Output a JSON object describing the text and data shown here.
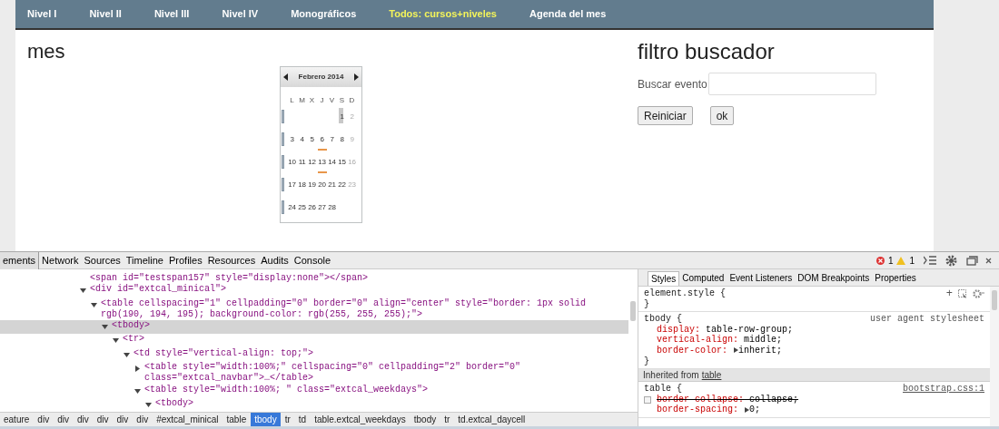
{
  "nav": {
    "items": [
      {
        "label": "Nivel I",
        "selected": false
      },
      {
        "label": "Nivel II",
        "selected": false
      },
      {
        "label": "Nivel III",
        "selected": false
      },
      {
        "label": "Nivel IV",
        "selected": false
      },
      {
        "label": "Monográficos",
        "selected": false
      },
      {
        "label": "Todos: cursos+niveles",
        "selected": true
      },
      {
        "label": "Agenda del mes",
        "selected": false
      }
    ]
  },
  "month_section": {
    "heading": "mes",
    "calendar": {
      "title": "Febrero 2014",
      "weekdays": [
        "L",
        "M",
        "X",
        "J",
        "V",
        "S",
        "D"
      ],
      "weeks": [
        [
          {
            "kind": "empty"
          },
          {
            "kind": "empty"
          },
          {
            "kind": "empty"
          },
          {
            "kind": "empty"
          },
          {
            "kind": "empty"
          },
          {
            "label": "1",
            "kind": "weekday",
            "event": false,
            "today": true
          },
          {
            "label": "2",
            "kind": "sunday",
            "event": false,
            "today": false
          }
        ],
        [
          {
            "label": "3",
            "kind": "weekday",
            "event": false,
            "today": false
          },
          {
            "label": "4",
            "kind": "weekday",
            "event": false,
            "today": false
          },
          {
            "label": "5",
            "kind": "weekday",
            "event": false,
            "today": false
          },
          {
            "label": "6",
            "kind": "weekday",
            "event": true,
            "today": false
          },
          {
            "label": "7",
            "kind": "weekday",
            "event": false,
            "today": false
          },
          {
            "label": "8",
            "kind": "weekday",
            "event": false,
            "today": false
          },
          {
            "label": "9",
            "kind": "sunday",
            "event": false,
            "today": false
          }
        ],
        [
          {
            "label": "10",
            "kind": "weekday",
            "event": false,
            "today": false
          },
          {
            "label": "11",
            "kind": "weekday",
            "event": false,
            "today": false
          },
          {
            "label": "12",
            "kind": "weekday",
            "event": false,
            "today": false
          },
          {
            "label": "13",
            "kind": "weekday",
            "event": true,
            "today": false
          },
          {
            "label": "14",
            "kind": "weekday",
            "event": false,
            "today": false
          },
          {
            "label": "15",
            "kind": "weekday",
            "event": false,
            "today": false
          },
          {
            "label": "16",
            "kind": "sunday",
            "event": false,
            "today": false
          }
        ],
        [
          {
            "label": "17",
            "kind": "weekday",
            "event": false,
            "today": false
          },
          {
            "label": "18",
            "kind": "weekday",
            "event": false,
            "today": false
          },
          {
            "label": "19",
            "kind": "weekday",
            "event": false,
            "today": false
          },
          {
            "label": "20",
            "kind": "weekday",
            "event": false,
            "today": false
          },
          {
            "label": "21",
            "kind": "weekday",
            "event": false,
            "today": false
          },
          {
            "label": "22",
            "kind": "weekday",
            "event": false,
            "today": false
          },
          {
            "label": "23",
            "kind": "sunday",
            "event": false,
            "today": false
          }
        ],
        [
          {
            "label": "24",
            "kind": "weekday",
            "event": false,
            "today": false
          },
          {
            "label": "25",
            "kind": "weekday",
            "event": false,
            "today": false
          },
          {
            "label": "26",
            "kind": "weekday",
            "event": false,
            "today": false
          },
          {
            "label": "27",
            "kind": "weekday",
            "event": false,
            "today": false
          },
          {
            "label": "28",
            "kind": "weekday",
            "event": false,
            "today": false
          },
          {
            "kind": "empty"
          },
          {
            "kind": "empty"
          }
        ]
      ]
    }
  },
  "filter_section": {
    "heading": "filtro buscador",
    "search_label": "Buscar evento",
    "buttons": [
      "Reiniciar",
      "ok"
    ]
  },
  "devtools": {
    "tabs": [
      {
        "label": "ements",
        "selected": true
      },
      {
        "label": "Network",
        "selected": false
      },
      {
        "label": "Sources",
        "selected": false
      },
      {
        "label": "Timeline",
        "selected": false
      },
      {
        "label": "Profiles",
        "selected": false
      },
      {
        "label": "Resources",
        "selected": false
      },
      {
        "label": "Audits",
        "selected": false
      },
      {
        "label": "Console",
        "selected": false
      }
    ],
    "error_count": "1",
    "warning_count": "1",
    "dom_tree": [
      {
        "kind": "leaf",
        "text": "<span id=\"testspan157\" style=\"display:none\"></span>",
        "selected": false
      },
      {
        "kind": "node",
        "text": "<div id=\"extcal_minical\">",
        "expanded": true,
        "selected": false,
        "children": [
          {
            "kind": "node",
            "text": "<table cellspacing=\"1\" cellpadding=\"0\" border=\"0\" align=\"center\" style=\"border: 1px solid rgb(190, 194, 195); background-color: rgb(255, 255, 255);\">",
            "expanded": true,
            "selected": false,
            "children": [
              {
                "kind": "node",
                "text": "<tbody>",
                "expanded": true,
                "selected": true,
                "children": [
                  {
                    "kind": "node",
                    "text": "<tr>",
                    "expanded": true,
                    "selected": false,
                    "children": [
                      {
                        "kind": "node",
                        "text": "<td style=\"vertical-align: top;\">",
                        "expanded": true,
                        "selected": false,
                        "children": [
                          {
                            "kind": "node",
                            "text": "<table style=\"width:100%;\" cellspacing=\"0\" cellpadding=\"2\" border=\"0\" class=\"extcal_navbar\">…</table>",
                            "expanded": false,
                            "selected": false
                          },
                          {
                            "kind": "node",
                            "text": "<table style=\"width:100%; \" class=\"extcal_weekdays\">",
                            "expanded": true,
                            "selected": false,
                            "children": [
                              {
                                "kind": "node",
                                "text": "<tbody>",
                                "expanded": true,
                                "selected": false
                              }
                            ]
                          }
                        ]
                      }
                    ]
                  }
                ]
              }
            ]
          }
        ]
      }
    ],
    "breadcrumbs": [
      {
        "label": "eature",
        "selected": false
      },
      {
        "label": "div",
        "selected": false
      },
      {
        "label": "div",
        "selected": false
      },
      {
        "label": "div",
        "selected": false
      },
      {
        "label": "div",
        "selected": false
      },
      {
        "label": "div",
        "selected": false
      },
      {
        "label": "div",
        "selected": false
      },
      {
        "label": "#extcal_minical",
        "selected": false
      },
      {
        "label": "table",
        "selected": false
      },
      {
        "label": "tbody",
        "selected": true
      },
      {
        "label": "tr",
        "selected": false
      },
      {
        "label": "td",
        "selected": false
      },
      {
        "label": "table.extcal_weekdays",
        "selected": false
      },
      {
        "label": "tbody",
        "selected": false
      },
      {
        "label": "tr",
        "selected": false
      },
      {
        "label": "td.extcal_daycell",
        "selected": false
      }
    ],
    "styles_tabs": [
      {
        "label": "Styles",
        "selected": true
      },
      {
        "label": "Computed",
        "selected": false
      },
      {
        "label": "Event Listeners",
        "selected": false
      },
      {
        "label": "DOM Breakpoints",
        "selected": false
      },
      {
        "label": "Properties",
        "selected": false
      }
    ],
    "rules": [
      {
        "kind": "rule",
        "selector": "element.style {",
        "add_label": "+",
        "close": "}"
      },
      {
        "kind": "rule",
        "selector": "tbody {",
        "source": "user agent stylesheet",
        "close": "}",
        "properties": [
          {
            "name": "display:",
            "value": "table-row-group;",
            "expandable": false,
            "enabled": true
          },
          {
            "name": "vertical-align:",
            "value": "middle;",
            "expandable": false,
            "enabled": true
          },
          {
            "name": "border-color:",
            "value": "inherit;",
            "expandable": true,
            "enabled": true
          }
        ]
      },
      {
        "kind": "inherited",
        "label": "Inherited from",
        "link": "table"
      },
      {
        "kind": "rule",
        "selector": "table {",
        "source": "bootstrap.css:1",
        "properties": [
          {
            "name": "border-collapse:",
            "value": "collapse;",
            "expandable": false,
            "enabled": false
          },
          {
            "name": "border-spacing:",
            "value": "0;",
            "expandable": true,
            "enabled": true
          }
        ]
      }
    ]
  }
}
